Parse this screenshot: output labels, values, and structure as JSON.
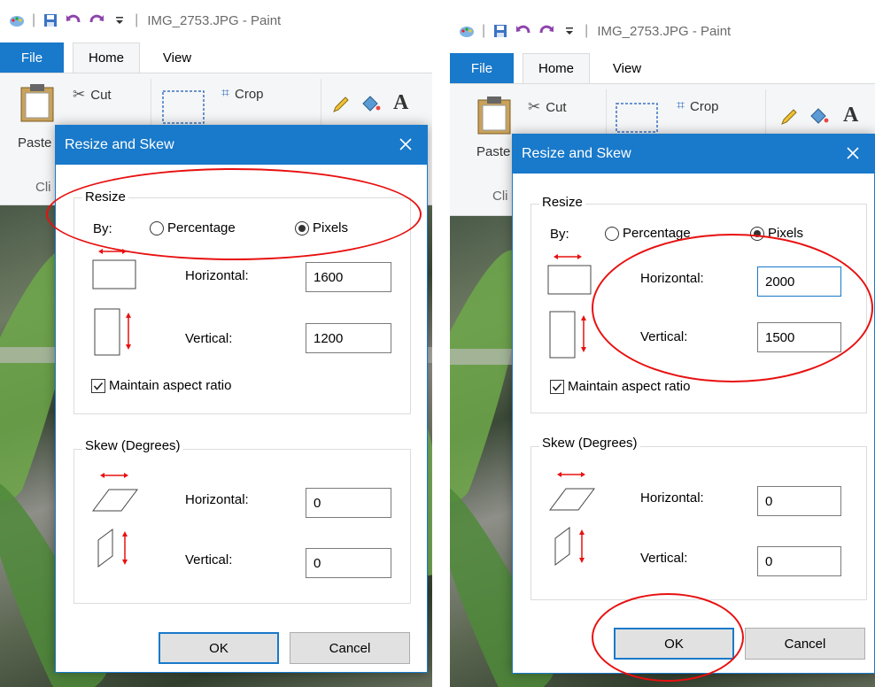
{
  "window": {
    "title": "IMG_2753.JPG - Paint"
  },
  "tabs": {
    "file": "File",
    "home": "Home",
    "view": "View"
  },
  "ribbon": {
    "paste": "Paste",
    "cut": "Cut",
    "crop": "Crop",
    "clipboard_partial": "Cli"
  },
  "dialog": {
    "title": "Resize and Skew",
    "resize_group": "Resize",
    "by_label": "By:",
    "percentage_label": "Percentage",
    "pixels_label": "Pixels",
    "horizontal_label": "Horizontal:",
    "vertical_label": "Vertical:",
    "maintain_label": "Maintain aspect ratio",
    "skew_group": "Skew (Degrees)",
    "ok_label": "OK",
    "cancel_label": "Cancel"
  },
  "left": {
    "resize_horizontal": "1600",
    "resize_vertical": "1200",
    "skew_horizontal": "0",
    "skew_vertical": "0"
  },
  "right": {
    "resize_horizontal": "2000",
    "resize_vertical": "1500",
    "skew_horizontal": "0",
    "skew_vertical": "0"
  },
  "colors": {
    "accent": "#1979ca",
    "annotation": "#e81010"
  }
}
